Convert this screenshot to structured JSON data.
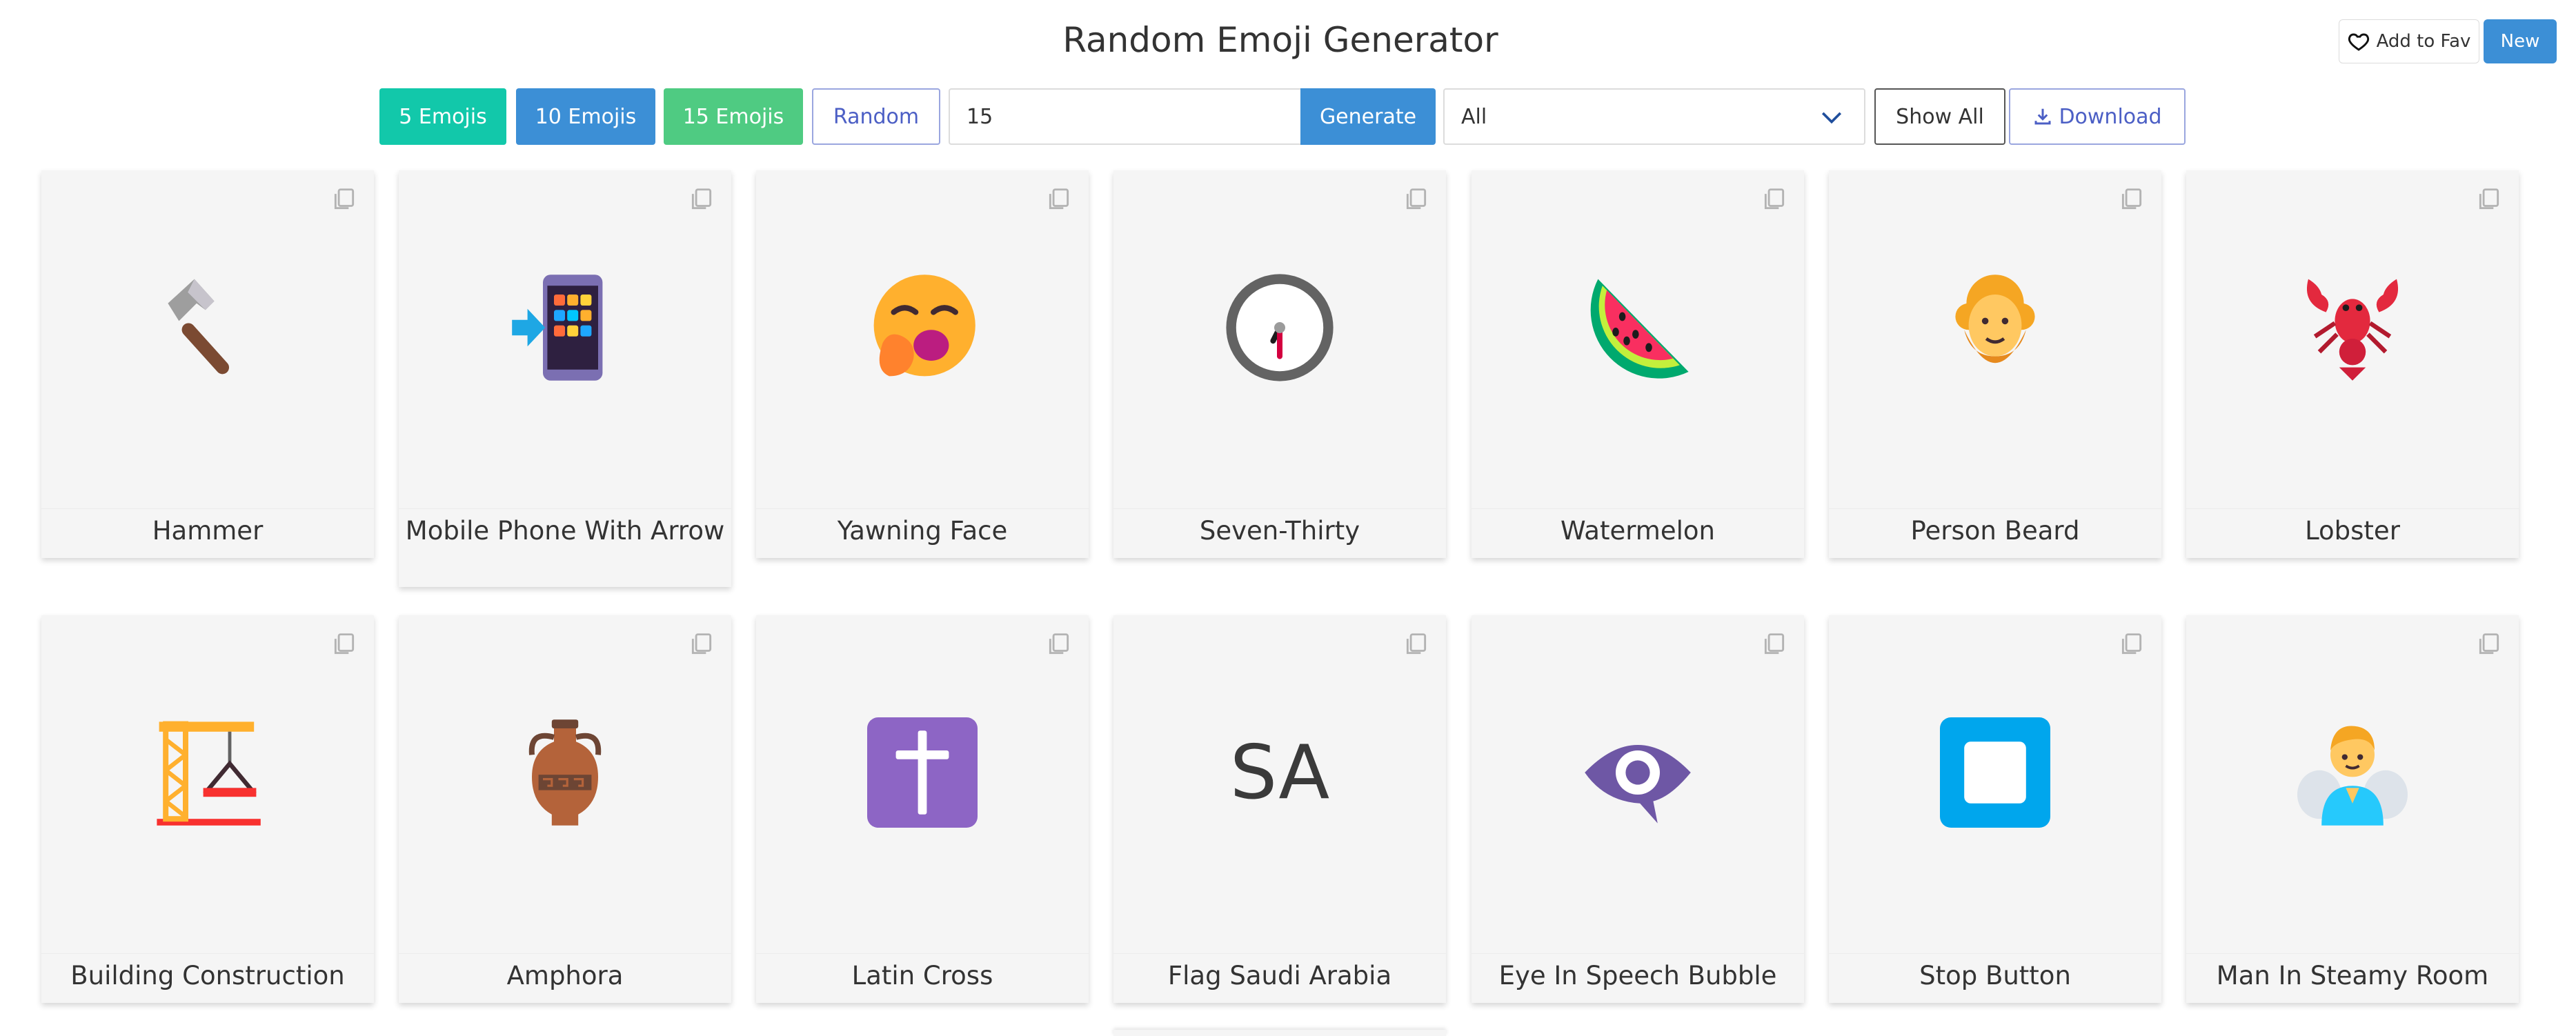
{
  "header": {
    "title": "Random Emoji Generator",
    "fav_label": "Add to Fav",
    "new_label": "New"
  },
  "toolbar": {
    "btn5": "5 Emojis",
    "btn10": "10 Emojis",
    "btn15": "15 Emojis",
    "random": "Random",
    "count_value": "15",
    "generate": "Generate",
    "category_selected": "All",
    "show_all": "Show All",
    "download": "Download"
  },
  "colors": {
    "teal": "#12c8aa",
    "blue": "#3c8fd6",
    "green": "#4fcb82",
    "outline_blue": "#4c5fc5",
    "card_bg": "#f5f5f5"
  },
  "emojis": [
    {
      "name": "Hammer",
      "icon": "hammer-icon"
    },
    {
      "name": "Mobile Phone With Arrow",
      "icon": "mobile-phone-arrow-icon"
    },
    {
      "name": "Yawning Face",
      "icon": "yawning-face-icon"
    },
    {
      "name": "Seven-Thirty",
      "icon": "seven-thirty-clock-icon"
    },
    {
      "name": "Watermelon",
      "icon": "watermelon-icon"
    },
    {
      "name": "Person Beard",
      "icon": "person-beard-icon"
    },
    {
      "name": "Lobster",
      "icon": "lobster-icon"
    },
    {
      "name": "Building Construction",
      "icon": "building-construction-icon"
    },
    {
      "name": "Amphora",
      "icon": "amphora-icon"
    },
    {
      "name": "Latin Cross",
      "icon": "latin-cross-icon"
    },
    {
      "name": "Flag Saudi Arabia",
      "icon": "flag-saudi-arabia-icon",
      "glyph_text": "SA"
    },
    {
      "name": "Eye In Speech Bubble",
      "icon": "eye-speech-bubble-icon"
    },
    {
      "name": "Stop Button",
      "icon": "stop-button-icon"
    },
    {
      "name": "Man In Steamy Room",
      "icon": "man-steamy-room-icon"
    }
  ]
}
